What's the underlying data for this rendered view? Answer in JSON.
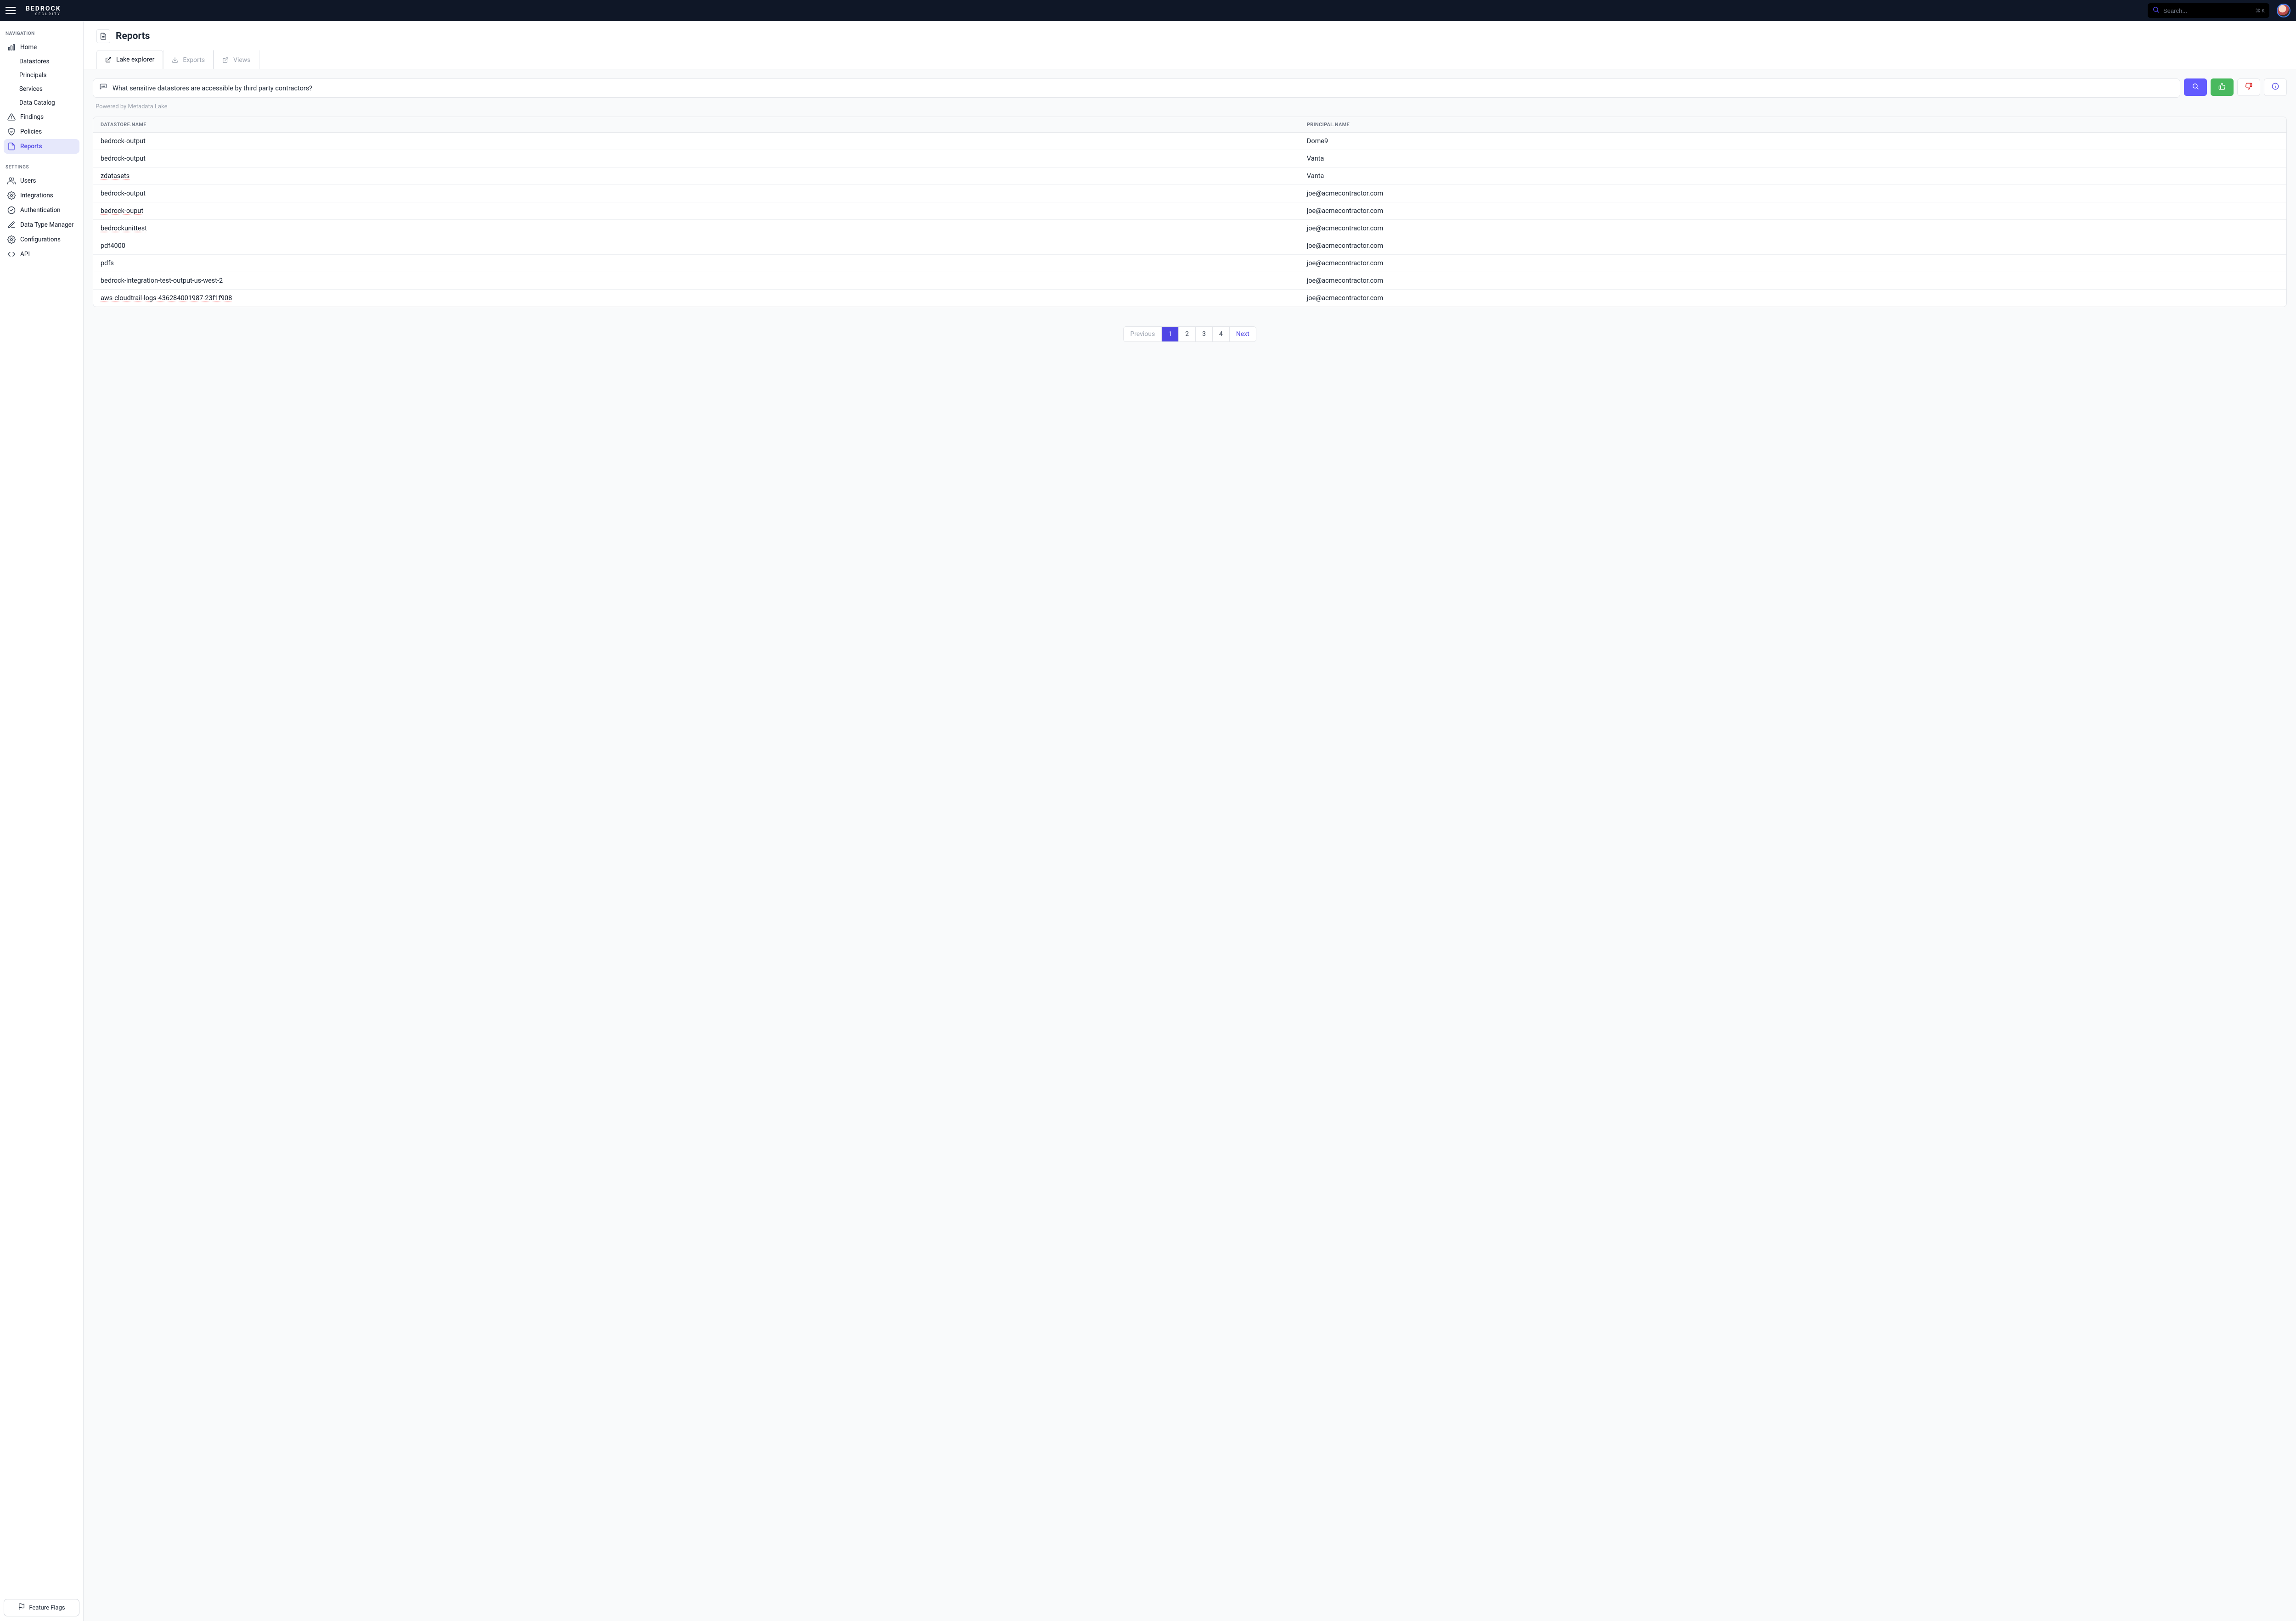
{
  "header": {
    "brand_main": "BEDROCK",
    "brand_sub": "SECURITY",
    "search_placeholder": "Search...",
    "search_shortcut": "⌘ K"
  },
  "sidebar": {
    "section_navigation_label": "NAVIGATION",
    "section_settings_label": "SETTINGS",
    "nav": {
      "home": "Home",
      "datastores": "Datastores",
      "principals": "Principals",
      "services": "Services",
      "data_catalog": "Data Catalog",
      "findings": "Findings",
      "policies": "Policies",
      "reports": "Reports"
    },
    "settings": {
      "users": "Users",
      "integrations": "Integrations",
      "authentication": "Authentication",
      "data_type_manager": "Data Type Manager",
      "configurations": "Configurations",
      "api": "API"
    },
    "feature_flags": "Feature Flags"
  },
  "page": {
    "title": "Reports",
    "tabs": {
      "lake_explorer": "Lake explorer",
      "exports": "Exports",
      "views": "Views"
    },
    "query_text": "What sensitive datastores are accessible  by third party contractors?",
    "powered_by": "Powered by Metadata Lake",
    "columns": {
      "datastore_name": "DATASTORE.NAME",
      "principal_name": "PRINCIPAL.NAME"
    },
    "rows": [
      {
        "ds": "bedrock-output",
        "pr": "Dome9",
        "link": false
      },
      {
        "ds": "bedrock-output",
        "pr": "Vanta",
        "link": false
      },
      {
        "ds": "zdatasets",
        "pr": "Vanta",
        "link": true
      },
      {
        "ds": "bedrock-output",
        "pr": "joe@acmecontractor.com",
        "link": false
      },
      {
        "ds": "bedrock-ouput",
        "pr": "joe@acmecontractor.com",
        "link": true
      },
      {
        "ds": "bedrockunittest",
        "pr": "joe@acmecontractor.com",
        "link": true
      },
      {
        "ds": "pdf4000",
        "pr": "joe@acmecontractor.com",
        "link": false
      },
      {
        "ds": "pdfs",
        "pr": "joe@acmecontractor.com",
        "link": false
      },
      {
        "ds": "bedrock-integration-test-output-us-west-2",
        "pr": "joe@acmecontractor.com",
        "link": false
      },
      {
        "ds": "aws-cloudtrail-logs-436284001987-23f1f908",
        "pr": "joe@acmecontractor.com",
        "link": true
      }
    ],
    "pagination": {
      "previous": "Previous",
      "pages": [
        "1",
        "2",
        "3",
        "4"
      ],
      "current": "1",
      "next": "Next"
    }
  }
}
